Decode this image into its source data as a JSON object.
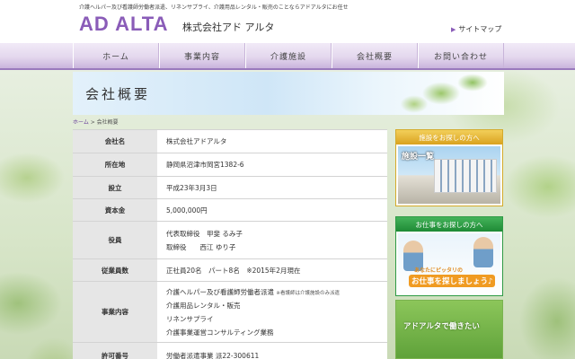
{
  "header": {
    "tagline": "介護ヘルパー及び看護師労働者派遣、リネンサプライ、介護用品レンタル・販売のことならアドアルタにお任せ",
    "logo": "AD ALTA",
    "company": "株式会社アド アルタ",
    "sitemap": "サイトマップ"
  },
  "nav": [
    "ホーム",
    "事業内容",
    "介護施設",
    "会社概要",
    "お問い合わせ"
  ],
  "page_title": "会社概要",
  "breadcrumb": {
    "home": "ホーム",
    "sep": " > ",
    "current": "会社概要"
  },
  "table": {
    "company_name": {
      "label": "会社名",
      "value": "株式会社アドアルタ"
    },
    "address": {
      "label": "所在地",
      "value": "静岡県沼津市岡宮1382-6"
    },
    "founded": {
      "label": "設立",
      "value": "平成23年3月3日"
    },
    "capital": {
      "label": "資本金",
      "value": "5,000,000円"
    },
    "officers": {
      "label": "役員",
      "line1": "代表取締役　甲斐 るみ子",
      "line2": "取締役　　西江 ゆり子"
    },
    "employees": {
      "label": "従業員数",
      "value": "正社員20名　パート8名　※2015年2月現在"
    },
    "business": {
      "label": "事業内容",
      "line1": "介護ヘルパー及び看護師労働者派遣",
      "line1_note": "※看護師は介護施設のみ派遣",
      "line2": "介護用品レンタル・販売",
      "line3": "リネンサプライ",
      "line4": "介護事業運営コンサルティング業務"
    },
    "license": {
      "label": "許可番号",
      "value": "労働者派遣事業 派22-300611"
    }
  },
  "side": {
    "facility_head": "施設をお探しの方へ",
    "facility_label": "施設一覧",
    "job_head": "お仕事をお探しの方へ",
    "job_line1": "あなたにピッタリの",
    "job_line2": "お仕事を探しましょう♪",
    "work_text": "アドアルタで働きたい"
  }
}
